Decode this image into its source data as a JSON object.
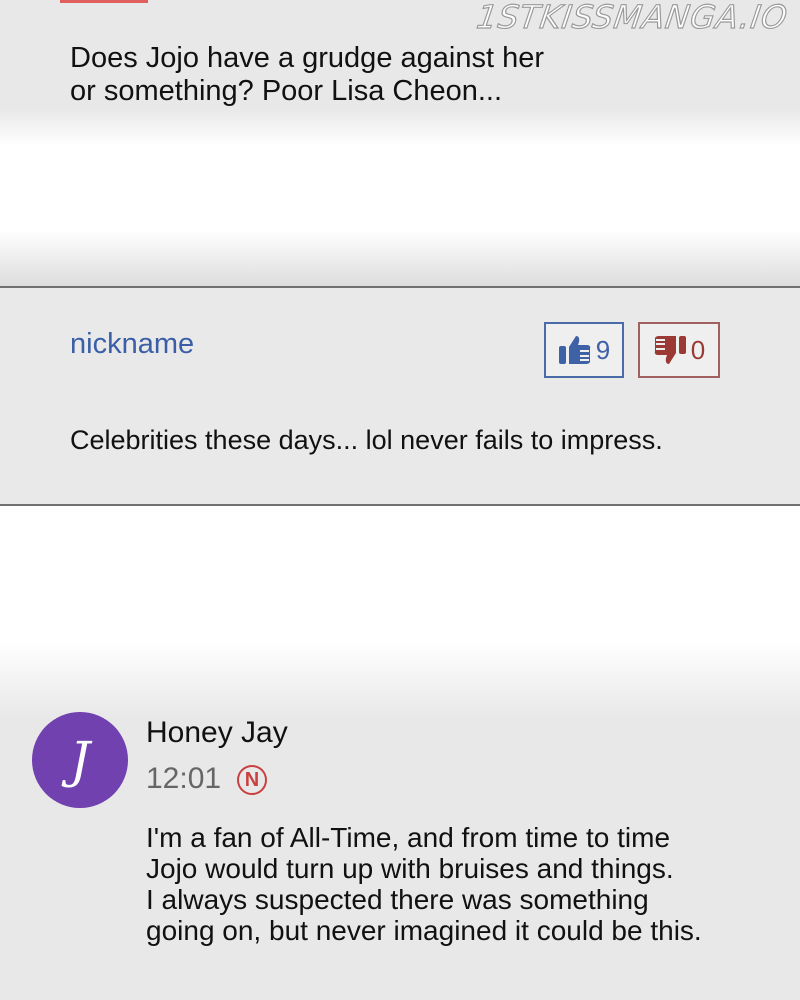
{
  "watermark": "1STKISSMANGA.IO",
  "comments": [
    {
      "text": "Does Jojo have a grudge against her\nor something? Poor Lisa Cheon..."
    },
    {
      "nickname": "nickname",
      "likes": "9",
      "dislikes": "0",
      "text": "Celebrities these days... lol never fails to impress."
    },
    {
      "avatar_initial": "J",
      "avatar_color": "#7141b0",
      "author": "Honey Jay",
      "time": "12:01",
      "new_badge": "N",
      "text": "I'm a fan of All-Time, and from time to time\nJojo would turn up with bruises and things.\nI always suspected there was something\ngoing on, but never imagined it could be this."
    }
  ],
  "colors": {
    "nickname": "#3a5fa8",
    "like": "#3f61a6",
    "dislike": "#9b3a35",
    "new_badge": "#c94040"
  },
  "icons": {
    "like": "thumbs-up-icon",
    "dislike": "thumbs-down-icon"
  }
}
